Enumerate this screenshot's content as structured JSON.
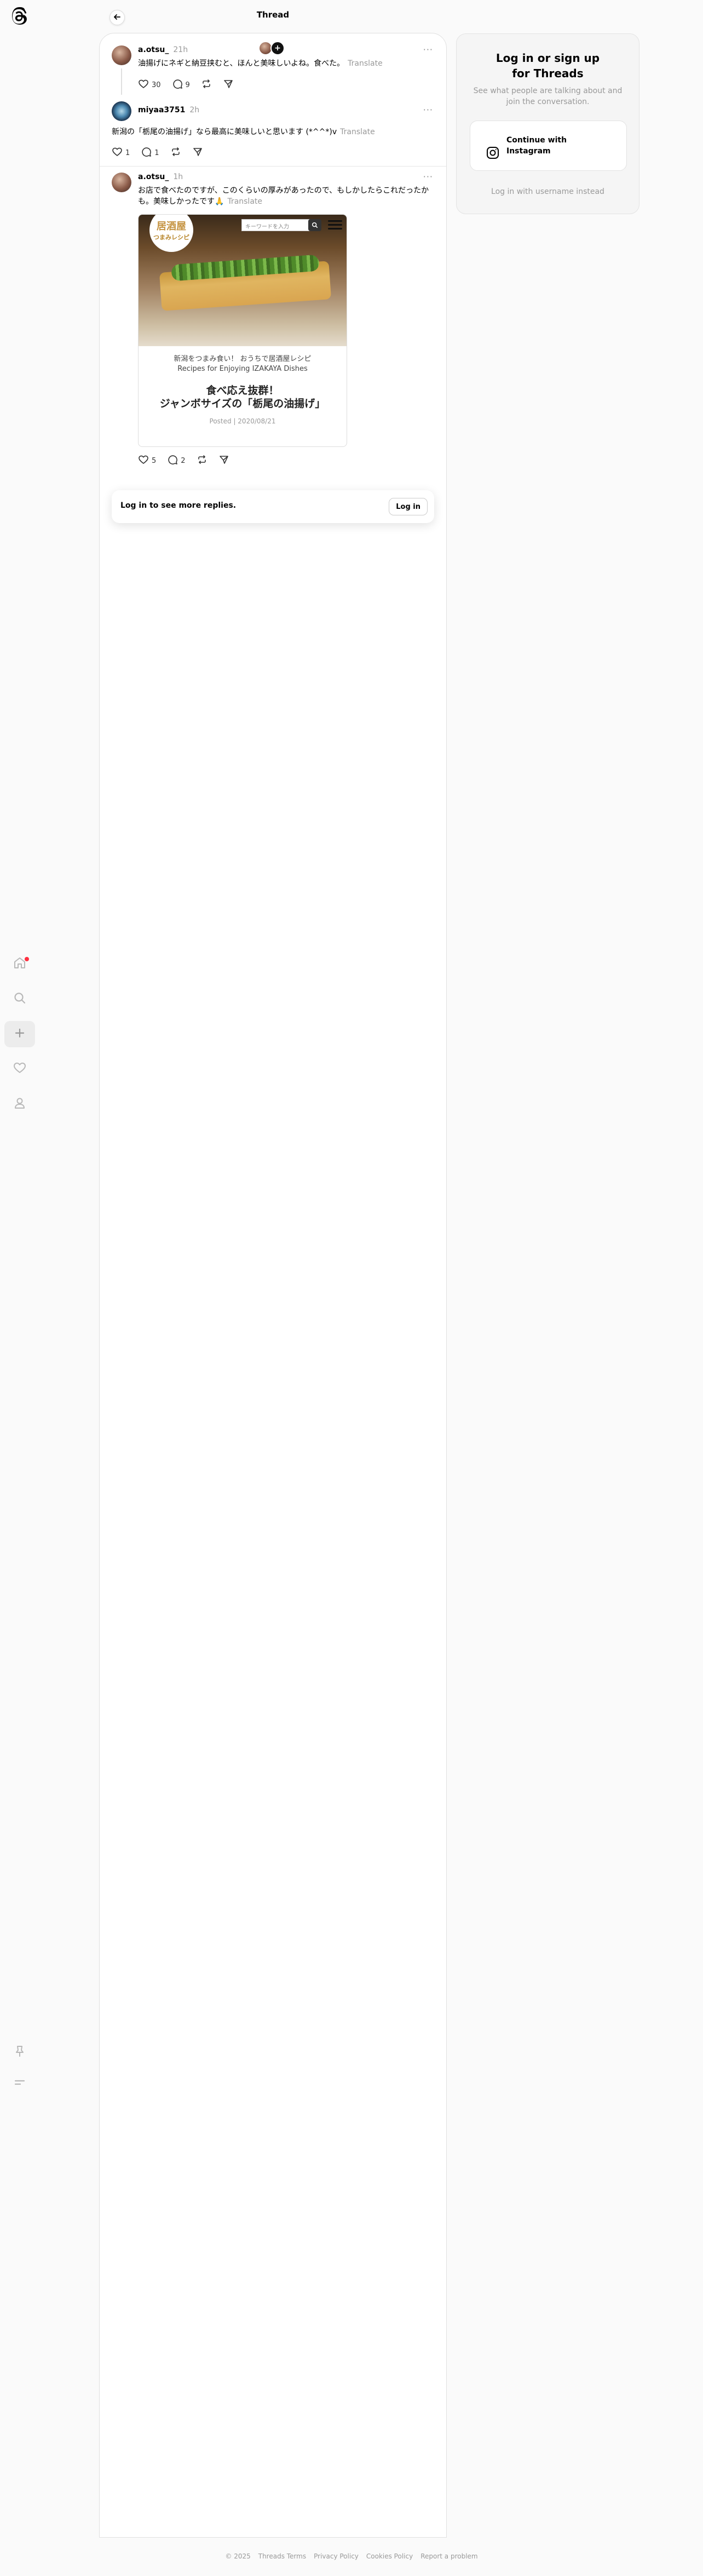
{
  "app": {
    "logo_name": "threads-logo"
  },
  "nav": {
    "items": [
      {
        "name": "home",
        "icon": "home-icon",
        "badge": true
      },
      {
        "name": "search",
        "icon": "search-icon"
      },
      {
        "name": "create",
        "icon": "plus-icon"
      },
      {
        "name": "activity",
        "icon": "heart-icon"
      },
      {
        "name": "profile",
        "icon": "person-icon"
      }
    ],
    "bottom": [
      {
        "name": "pin",
        "icon": "pin-icon"
      },
      {
        "name": "menu",
        "icon": "menu-icon"
      }
    ]
  },
  "header": {
    "title": "Thread"
  },
  "posts": [
    {
      "username": "a.otsu_",
      "time": "21h",
      "text": "油揚げにネギと納豆挟むと、ほんと美味しいよね。食べた。",
      "translate": "Translate",
      "likes": "30",
      "replies": "9"
    },
    {
      "username": "miyaa3751",
      "time": "2h",
      "text": "新潟の「栃尾の油揚げ」なら最高に美味しいと思います (*^^*)v",
      "translate": "Translate",
      "likes": "1",
      "replies": "1"
    },
    {
      "username": "a.otsu_",
      "time": "1h",
      "text": "お店で食べたのですが、このくらいの厚みがあったので、もしかしたらこれだったかも。美味しかったです🙏",
      "translate": "Translate",
      "likes": "5",
      "replies": "2",
      "card": {
        "logo_top": "居酒屋",
        "logo_bottom": "つまみレシピ",
        "search_placeholder": "キーワードを入力",
        "sub1": "新潟をつまみ食い！ おうちで居酒屋レシピ",
        "sub2": "Recipes for Enjoying IZAKAYA Dishes",
        "title1": "食べ応え抜群！",
        "title2": "ジャンボサイズの「栃尾の油揚げ」",
        "posted": "Posted | 2020/08/21"
      }
    }
  ],
  "more_replies": {
    "text": "Log in to see more replies.",
    "button": "Log in"
  },
  "login_panel": {
    "title_line1": "Log in or sign up",
    "title_line2": "for Threads",
    "subtitle": "See what people are talking about and join the conversation.",
    "instagram_label": "Continue with Instagram",
    "alt_link": "Log in with username instead"
  },
  "footer": {
    "items": [
      "© 2025",
      "Threads Terms",
      "Privacy Policy",
      "Cookies Policy",
      "Report a problem"
    ]
  },
  "colors": {
    "accent": "#ff3040",
    "muted": "#999999"
  }
}
